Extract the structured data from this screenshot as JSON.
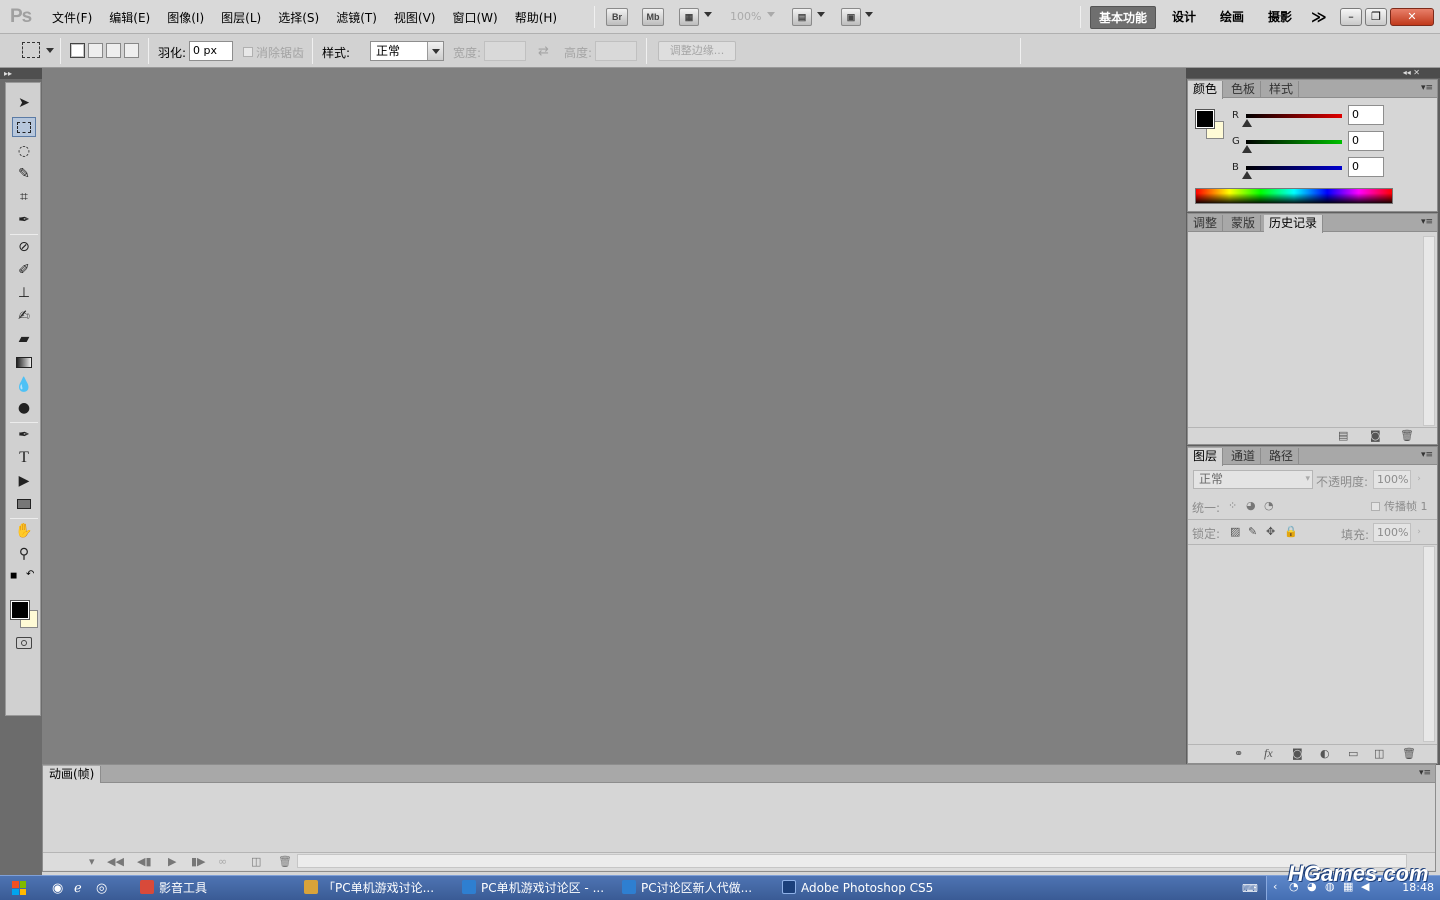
{
  "app": {
    "logo": "Ps"
  },
  "menu": [
    {
      "label": "文件(F)"
    },
    {
      "label": "编辑(E)"
    },
    {
      "label": "图像(I)"
    },
    {
      "label": "图层(L)"
    },
    {
      "label": "选择(S)"
    },
    {
      "label": "滤镜(T)"
    },
    {
      "label": "视图(V)"
    },
    {
      "label": "窗口(W)"
    },
    {
      "label": "帮助(H)"
    }
  ],
  "appbar": {
    "bridge": "Br",
    "minibridge": "Mb",
    "zoom": "100%"
  },
  "workspaces": {
    "active": "基本功能",
    "items": [
      "设计",
      "绘画",
      "摄影"
    ],
    "more": "≫"
  },
  "window_controls": {
    "minimize": "–",
    "restore": "❐",
    "close": "✕"
  },
  "options": {
    "feather_label": "羽化:",
    "feather_value": "0 px",
    "antialias_label": "消除锯齿",
    "style_label": "样式:",
    "style_value": "正常",
    "width_label": "宽度:",
    "height_label": "高度:",
    "swap": "⇄",
    "refine_edge": "调整边缘..."
  },
  "color_panel": {
    "tabs": [
      "颜色",
      "色板",
      "样式"
    ],
    "channels": [
      {
        "label": "R",
        "value": "0",
        "color": "#d00000"
      },
      {
        "label": "G",
        "value": "0",
        "color": "#00a000"
      },
      {
        "label": "B",
        "value": "0",
        "color": "#0000c0"
      }
    ],
    "foreground": "#000000",
    "background": "#fffbd6"
  },
  "history_panel": {
    "tabs": [
      "调整",
      "蒙版",
      "历史记录"
    ]
  },
  "layers_panel": {
    "tabs": [
      "图层",
      "通道",
      "路径"
    ],
    "blend_mode": "正常",
    "opacity_label": "不透明度:",
    "opacity_value": "100%",
    "unify_label": "统一:",
    "propagate_label": "传播帧 1",
    "lock_label": "锁定:",
    "fill_label": "填充:",
    "fill_value": "100%"
  },
  "animation_panel": {
    "tab": "动画(帧)"
  },
  "taskbar": {
    "items": [
      {
        "label": "影音工具",
        "color": "#d84a3a"
      },
      {
        "label": "「PC单机游戏讨论...",
        "color": "#d8a33a"
      },
      {
        "label": "PC单机游戏讨论区 - ...",
        "color": "#2e7fd1"
      },
      {
        "label": "PC讨论区新人代做...",
        "color": "#2e7fd1"
      },
      {
        "label": "Adobe Photoshop CS5",
        "color": "#1b3f7a"
      }
    ],
    "clock": "18:48",
    "watermark": "HGames.com"
  }
}
